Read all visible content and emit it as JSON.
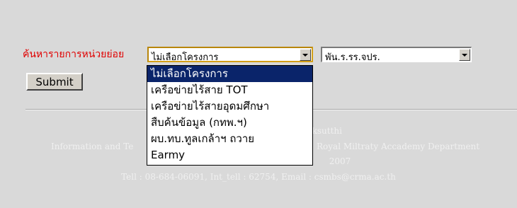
{
  "form": {
    "search_label": "ค้นหารายการหน่วยย่อย",
    "project_select": {
      "value": "ไม่เลือกโครงการ",
      "options": [
        "ไม่เลือกโครงการ",
        "เครือข่ายไร้สาย TOT",
        "เครือข่ายไร้สายอุดมศึกษา",
        "สืบค้นข้อมูล (กทพ.ฯ)",
        "ผบ.ทบ.ทูลเกล้าฯ ถวาย",
        "Earmy"
      ],
      "selected_index": 0
    },
    "unit_select": {
      "value": "พัน.ร.รร.จปร."
    },
    "submit_label": "Submit"
  },
  "footer": {
    "line1": "avan Suksutthi",
    "line2_left": "Information and Te",
    "line2_right": "Royal Miltraty Accademy Department",
    "line3": "2007",
    "line4": "Tell : 08-684-06091, Int_tell : 62754, Email : csmbs@crma.ac.th"
  },
  "colors": {
    "background": "#d9d9d9",
    "label": "#e00000",
    "selection": "#0a246a",
    "footer_text": "#f0f0f0"
  }
}
